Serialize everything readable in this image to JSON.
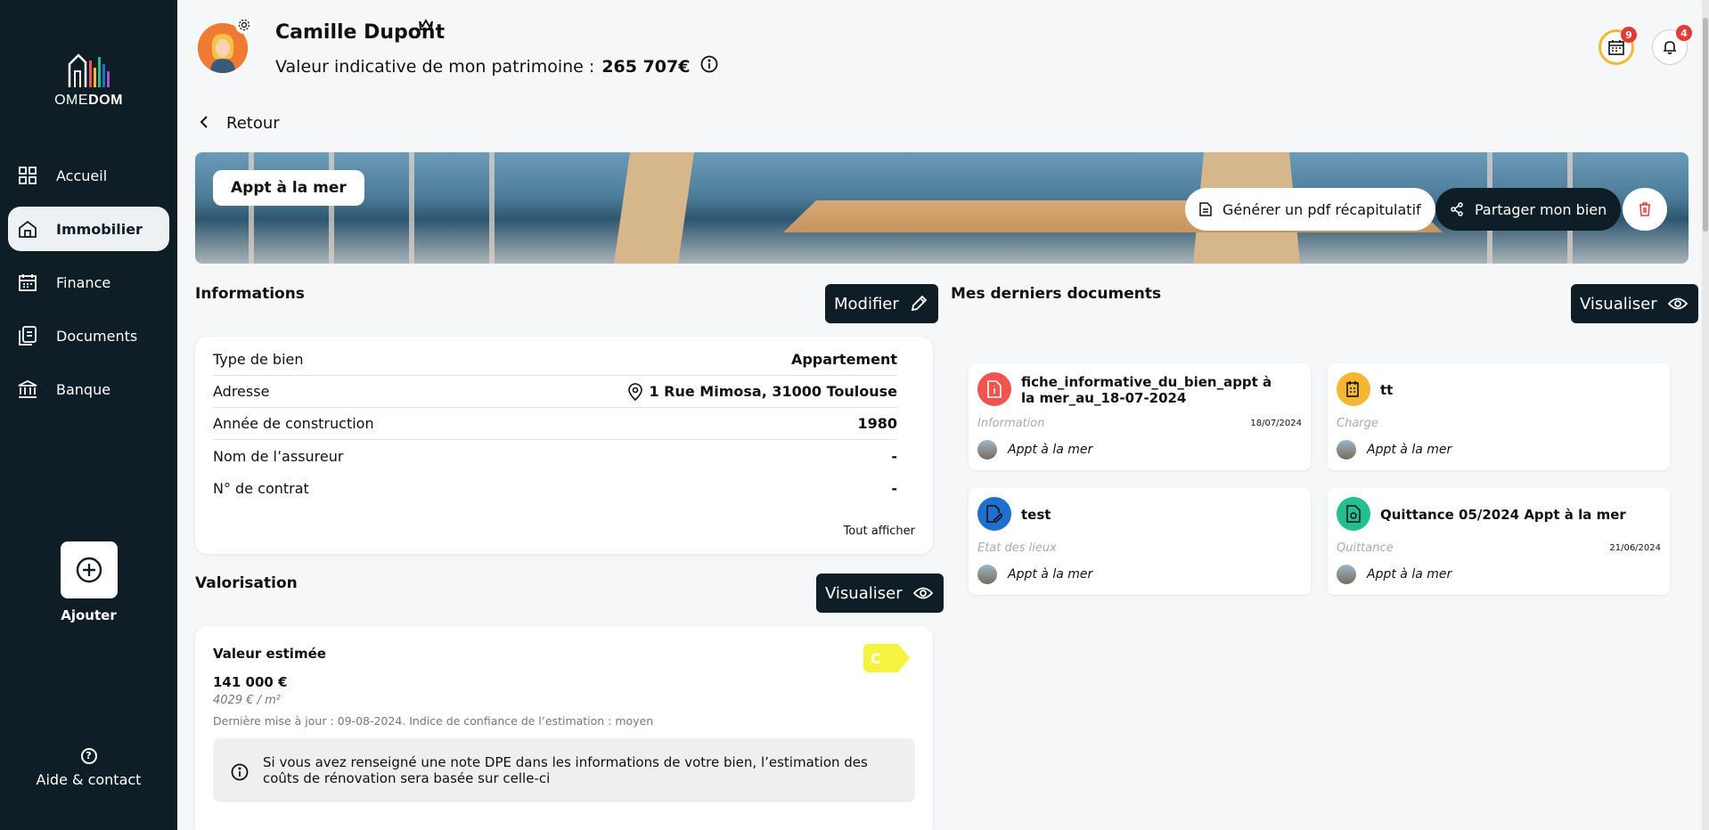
{
  "sidebar": {
    "logo": {
      "part1": "OME",
      "part2": "DOM"
    },
    "items": [
      {
        "label": "Accueil",
        "icon": "grid-icon"
      },
      {
        "label": "Immobilier",
        "icon": "home-icon",
        "active": true
      },
      {
        "label": "Finance",
        "icon": "calendar-icon"
      },
      {
        "label": "Documents",
        "icon": "documents-icon"
      },
      {
        "label": "Banque",
        "icon": "bank-icon"
      }
    ],
    "add_label": "Ajouter",
    "help_label": "Aide & contact"
  },
  "header": {
    "user_name": "Camille Dupont",
    "patrimoine_label": "Valeur indicative de mon patrimoine :",
    "patrimoine_value": "265 707€",
    "calendar_badge": "9",
    "notifications_badge": "4"
  },
  "back_label": "Retour",
  "banner": {
    "property_name": "Appt à la mer",
    "pdf_button": "Générer un pdf récapitulatif",
    "share_button": "Partager mon bien"
  },
  "informations": {
    "title": "Informations",
    "edit_button": "Modifier",
    "rows": [
      {
        "label": "Type de bien",
        "value": "Appartement"
      },
      {
        "label": "Adresse",
        "value": "1 Rue Mimosa, 31000 Toulouse"
      },
      {
        "label": "Année de construction",
        "value": "1980"
      },
      {
        "label": "Nom de l’assureur",
        "value": "-"
      },
      {
        "label": "N° de contrat",
        "value": "-"
      }
    ],
    "show_all": "Tout afficher"
  },
  "valorisation": {
    "title": "Valorisation",
    "view_button": "Visualiser",
    "estimated_label": "Valeur estimée",
    "estimated_value": "141 000 €",
    "per_m2": "4029 € / m²",
    "last_update": "Dernière mise à jour : 09-08-2024. Indice de confiance de l’estimation : moyen",
    "dpe_class": "C",
    "dpe_color": "#f5f240",
    "notice": "Si vous avez renseigné une note DPE dans les informations de votre bien, l’estimation des coûts de rénovation sera basée sur celle-ci"
  },
  "documents": {
    "title": "Mes derniers documents",
    "view_button": "Visualiser",
    "items": [
      {
        "title": "fiche_informative_du_bien_appt à la mer_au_18-07-2024",
        "category": "Information",
        "date": "18/07/2024",
        "property": "Appt à la mer",
        "color": "#f0544f"
      },
      {
        "title": "tt",
        "category": "Charge",
        "date": "",
        "property": "Appt à la mer",
        "color": "#f5b731"
      },
      {
        "title": "test",
        "category": "Etat des lieux",
        "date": "",
        "property": "Appt à la mer",
        "color": "#1f6fd1"
      },
      {
        "title": "Quittance 05/2024 Appt à la mer",
        "category": "Quittance",
        "date": "21/06/2024",
        "property": "Appt à la mer",
        "color": "#22c08e"
      }
    ]
  }
}
